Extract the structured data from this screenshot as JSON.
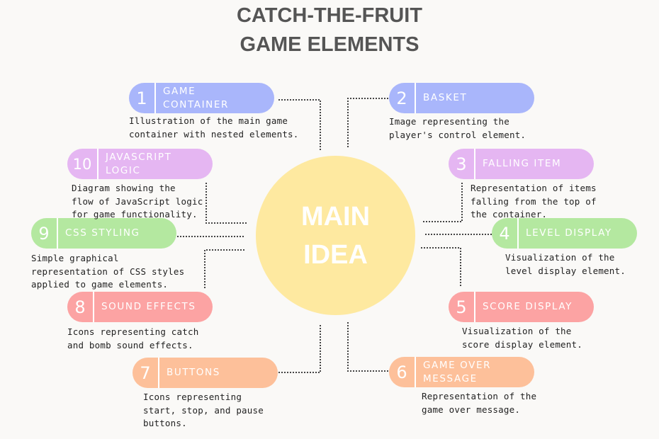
{
  "title": {
    "line1": "CATCH-THE-FRUIT",
    "line2": "GAME ELEMENTS"
  },
  "center": {
    "line1": "MAIN",
    "line2": "IDEA",
    "color": "#fee9a0"
  },
  "colors": {
    "blue": "#a9b6fb",
    "purple": "#e5b6f2",
    "green": "#b4e8a0",
    "red": "#fca3a3",
    "orange": "#fdc09a"
  },
  "elements": [
    {
      "number": "1",
      "label": "GAME\nCONTAINER",
      "description": "Illustration of the main game\ncontainer with nested elements.",
      "color": "#a9b6fb"
    },
    {
      "number": "2",
      "label": "BASKET",
      "description": "Image representing the\nplayer's control element.",
      "color": "#a9b6fb"
    },
    {
      "number": "3",
      "label": "FALLING ITEM",
      "description": "Representation of items\nfalling from the top of\nthe container.",
      "color": "#e5b6f2"
    },
    {
      "number": "4",
      "label": "LEVEL DISPLAY",
      "description": "Visualization of the\nlevel display element.",
      "color": "#b4e8a0"
    },
    {
      "number": "5",
      "label": "SCORE DISPLAY",
      "description": "Visualization of the\nscore display element.",
      "color": "#fca3a3"
    },
    {
      "number": "6",
      "label": "GAME OVER\nMESSAGE",
      "description": "Representation of the\ngame over message.",
      "color": "#fdc09a"
    },
    {
      "number": "7",
      "label": "BUTTONS",
      "description": "Icons representing\nstart, stop, and pause\nbuttons.",
      "color": "#fdc09a"
    },
    {
      "number": "8",
      "label": "SOUND EFFECTS",
      "description": "Icons representing catch\nand bomb sound effects.",
      "color": "#fca3a3"
    },
    {
      "number": "9",
      "label": "CSS STYLING",
      "description": "Simple graphical\nrepresentation of CSS styles\napplied to game elements.",
      "color": "#b4e8a0"
    },
    {
      "number": "10",
      "label": "JAVASCRIPT\nLOGIC",
      "description": "Diagram showing the\nflow of JavaScript logic\nfor game functionality.",
      "color": "#e5b6f2"
    }
  ]
}
